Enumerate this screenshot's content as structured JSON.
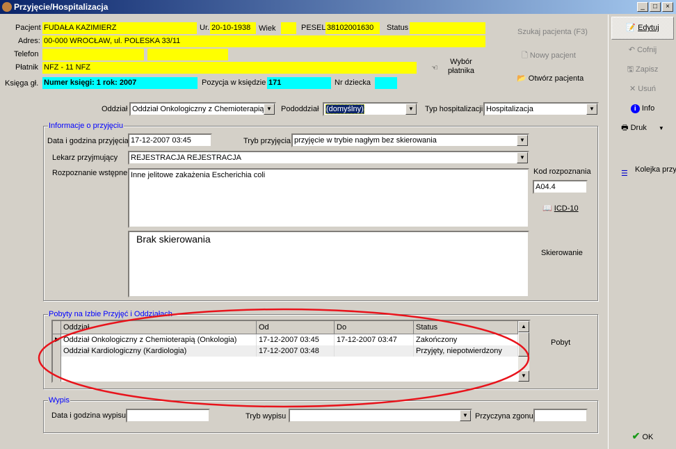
{
  "window": {
    "title": "Przyjęcie/Hospitalizacja",
    "controls": [
      "_",
      "□",
      "×"
    ]
  },
  "patient": {
    "pacjent_label": "Pacjent",
    "pacjent": "FUDAŁA KAZIMIERZ",
    "ur_label": "Ur.",
    "ur": "20-10-1938",
    "wiek_label": "Wiek",
    "wiek": "",
    "pesel_label": "PESEL",
    "pesel": "38102001630",
    "status_label": "Status",
    "status": "",
    "adres_label": "Adres:",
    "adres": "00-000 WROCŁAW, ul. POLESKA 33/11",
    "telefon_label": "Telefon",
    "telefon1": "",
    "telefon2": "",
    "platnik_label": "Płatnik",
    "platnik": "NFZ - 11 NFZ",
    "wybor_platnika": "Wybór płatnika",
    "ksiega_label": "Księga gł.",
    "ksiega": "Numer księgi: 1 rok: 2007",
    "pozycja_label": "Pozycja w księdzie",
    "pozycja": "171",
    "nr_dziecka_label": "Nr dziecka",
    "nr_dziecka": ""
  },
  "actions": {
    "szukaj": "Szukaj pacjenta (F3)",
    "nowy": "Nowy pacjent",
    "otworz": "Otwórz pacjenta"
  },
  "admission": {
    "oddzial_label": "Oddział",
    "oddzial": "Oddział Onkologiczny z Chemioterapią (",
    "pododdzial_label": "Pododdział",
    "pododdzial": "(domyślny)",
    "typ_label": "Typ hospitalizacji",
    "typ": "Hospitalizacja"
  },
  "info": {
    "title": "Informacje o przyjęciu",
    "data_label": "Data i godzina przyjęcia",
    "data": "17-12-2007 03:45",
    "tryb_label": "Tryb przyjęcia",
    "tryb": "przyjęcie w trybie nagłym bez skierowania",
    "lekarz_label": "Lekarz przyjmujący",
    "lekarz": "REJESTRACJA REJESTRACJA",
    "rozpoznanie_label": "Rozpoznanie wstępne",
    "rozpoznanie": "Inne jelitowe zakażenia Escherichia coli",
    "kod_label": "Kod rozpoznania",
    "kod": "A04.4",
    "icd_button": "ICD-10",
    "skierowanie_text": "Brak skierowania",
    "skierowanie_button": "Skierowanie"
  },
  "stays": {
    "title": "Pobyty na Izbie Przyjęć i Oddziałach",
    "columns": [
      "Oddział",
      "Od",
      "Do",
      "Status"
    ],
    "rows": [
      [
        "Oddział Onkologiczny z Chemioterapią (Onkologia)",
        "17-12-2007 03:45",
        "17-12-2007 03:47",
        "Zakończony"
      ],
      [
        "Oddział Kardiologiczny (Kardiologia)",
        "17-12-2007 03:48",
        "",
        "Przyjęty, niepotwierdzony"
      ]
    ],
    "pobyt_button": "Pobyt",
    "annotation_color": "#e8131b"
  },
  "discharge": {
    "title": "Wypis",
    "data_label": "Data i godzina wypisu",
    "data": "",
    "tryb_label": "Tryb wypisu",
    "tryb": "",
    "przyczyna_label": "Przyczyna zgonu",
    "przyczyna": ""
  },
  "toolbar": {
    "edytuj": "Edytuj",
    "cofnij": "Cofnij",
    "zapisz": "Zapisz",
    "usun": "Usuń",
    "info": "Info",
    "druk": "Druk",
    "kolejka": "Kolejka przyjęć",
    "ok": "OK"
  }
}
